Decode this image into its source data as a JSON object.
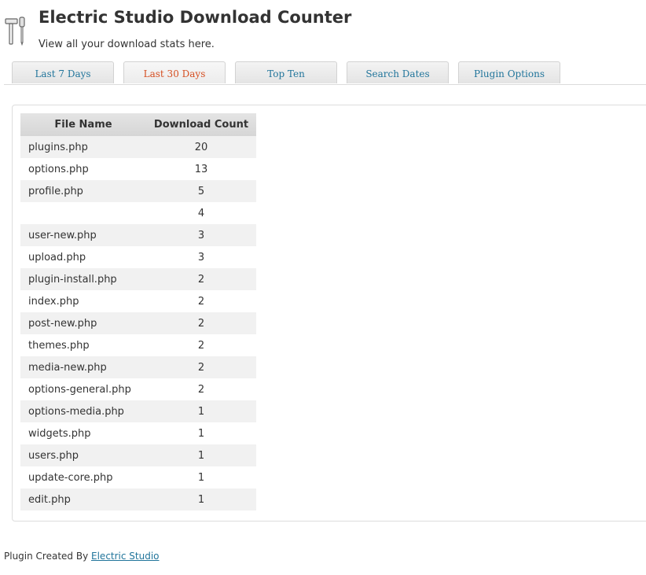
{
  "header": {
    "title": "Electric Studio Download Counter",
    "subtitle": "View all your download stats here.",
    "icon": "tools-icon"
  },
  "tabs": [
    {
      "label": "Last 7 Days",
      "active": false
    },
    {
      "label": "Last 30 Days",
      "active": true
    },
    {
      "label": "Top Ten",
      "active": false
    },
    {
      "label": "Search Dates",
      "active": false
    },
    {
      "label": "Plugin Options",
      "active": false
    }
  ],
  "table": {
    "columns": [
      "File Name",
      "Download Count"
    ],
    "rows": [
      {
        "file": "plugins.php",
        "count": "20"
      },
      {
        "file": "options.php",
        "count": "13"
      },
      {
        "file": "profile.php",
        "count": "5"
      },
      {
        "file": "",
        "count": "4"
      },
      {
        "file": "user-new.php",
        "count": "3"
      },
      {
        "file": "upload.php",
        "count": "3"
      },
      {
        "file": "plugin-install.php",
        "count": "2"
      },
      {
        "file": "index.php",
        "count": "2"
      },
      {
        "file": "post-new.php",
        "count": "2"
      },
      {
        "file": "themes.php",
        "count": "2"
      },
      {
        "file": "media-new.php",
        "count": "2"
      },
      {
        "file": "options-general.php",
        "count": "2"
      },
      {
        "file": "options-media.php",
        "count": "1"
      },
      {
        "file": "widgets.php",
        "count": "1"
      },
      {
        "file": "users.php",
        "count": "1"
      },
      {
        "file": "update-core.php",
        "count": "1"
      },
      {
        "file": "edit.php",
        "count": "1"
      }
    ]
  },
  "footer": {
    "text": "Plugin Created By",
    "link_label": "Electric Studio"
  },
  "colors": {
    "link": "#21759b",
    "active_tab": "#d54e21",
    "row_alt": "#f1f1f1",
    "header_bg": "#dcdcdc"
  }
}
